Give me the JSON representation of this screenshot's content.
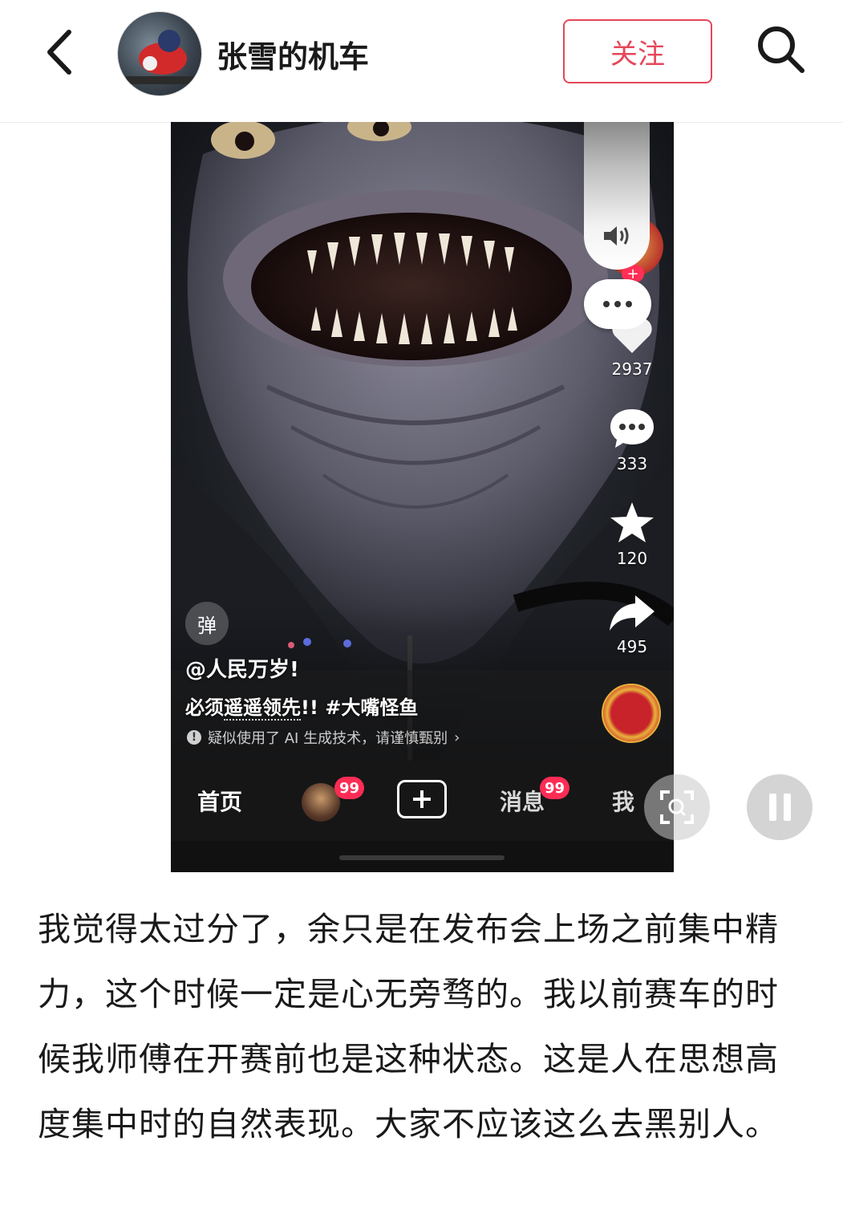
{
  "header": {
    "username": "张雪的机车",
    "follow_label": "关注"
  },
  "video": {
    "author_handle": "@人民万岁!",
    "description_prefix": "必须",
    "description_link": "遥遥领先",
    "description_suffix": "!!",
    "hashtag": "#大嘴怪鱼",
    "ai_notice": "疑似使用了 AI 生成技术，请谨慎甄别",
    "ai_notice_arrow": "›",
    "danmaku_label": "弹",
    "actions": {
      "likes": "2937",
      "comments": "333",
      "favorites": "120",
      "shares": "495"
    },
    "nav": {
      "home": "首页",
      "friends_badge": "99",
      "messages": "消息",
      "messages_badge": "99",
      "me": "我"
    }
  },
  "post": {
    "text": "我觉得太过分了，余只是在发布会上场之前集中精力，这个时候一定是心无旁骛的。我以前赛车的时候我师傅在开赛前也是这种状态。这是人在思想高度集中时的自然表现。大家不应该这么去黑别人。"
  },
  "colors": {
    "accent": "#e5475a",
    "badge": "#fe2c55",
    "nav_bg": "#161616"
  },
  "icons": [
    "back-icon",
    "search-icon",
    "volume-icon",
    "more-icon",
    "heart-icon",
    "comment-icon",
    "star-icon",
    "share-icon",
    "plus-icon",
    "scan-icon",
    "pause-icon",
    "info-icon"
  ]
}
